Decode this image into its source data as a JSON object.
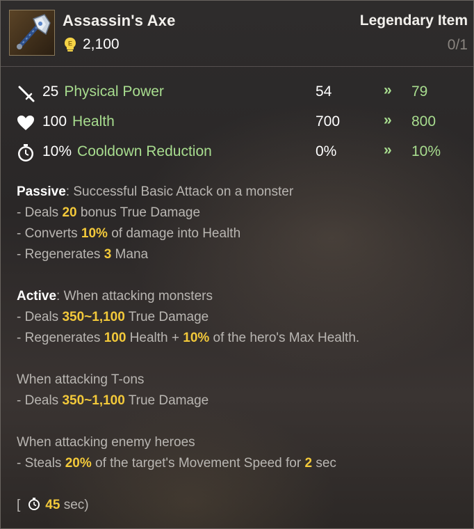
{
  "item": {
    "name": "Assassin's Axe",
    "price": "2,100",
    "rarity": "Legendary Item",
    "count": "0/1",
    "icon": "axe-icon",
    "coin_icon": "gold-coin-icon"
  },
  "stats": [
    {
      "icon": "sword-icon",
      "amount": "25",
      "name": "Physical Power",
      "current": "54",
      "arrow": "»",
      "next": "79"
    },
    {
      "icon": "heart-icon",
      "amount": "100",
      "name": "Health",
      "current": "700",
      "arrow": "»",
      "next": "800"
    },
    {
      "icon": "clock-icon",
      "amount": "10%",
      "name": "Cooldown Reduction",
      "current": "0%",
      "arrow": "»",
      "next": "10%"
    }
  ],
  "passive": {
    "keyword": "Passive",
    "sep": ": ",
    "trigger": "Successful Basic Attack on a monster",
    "line1": {
      "a": "- Deals ",
      "v": "20",
      "b": " bonus True Damage"
    },
    "line2": {
      "a": "- Converts ",
      "v": "10%",
      "b": " of damage into Health"
    },
    "line3": {
      "a": "- Regenerates ",
      "v": "3",
      "b": " Mana"
    }
  },
  "active": {
    "keyword": "Active",
    "sep": ": ",
    "trigger": "When attacking monsters",
    "line1": {
      "a": "- Deals ",
      "v": "350~1,100",
      "b": " True Damage"
    },
    "line2": {
      "a": "- Regenerates ",
      "v1": "100",
      "m": " Health + ",
      "v2": "10%",
      "b": " of the hero's Max Health."
    },
    "tons_header": "When attacking T-ons",
    "tons_line": {
      "a": "- Deals ",
      "v": "350~1,100",
      "b": " True Damage"
    },
    "heroes_header": "When attacking enemy heroes",
    "heroes_line": {
      "a": "- Steals ",
      "v1": "20%",
      "m": " of the target's Movement Speed for ",
      "v2": "2",
      "b": " sec"
    }
  },
  "cooldown": {
    "open": "[",
    "value": "45",
    "unit": " sec",
    "close": ")"
  },
  "colors": {
    "green": "#a8dd8f",
    "gold": "#f3c93a",
    "text": "#b9b6b2"
  }
}
